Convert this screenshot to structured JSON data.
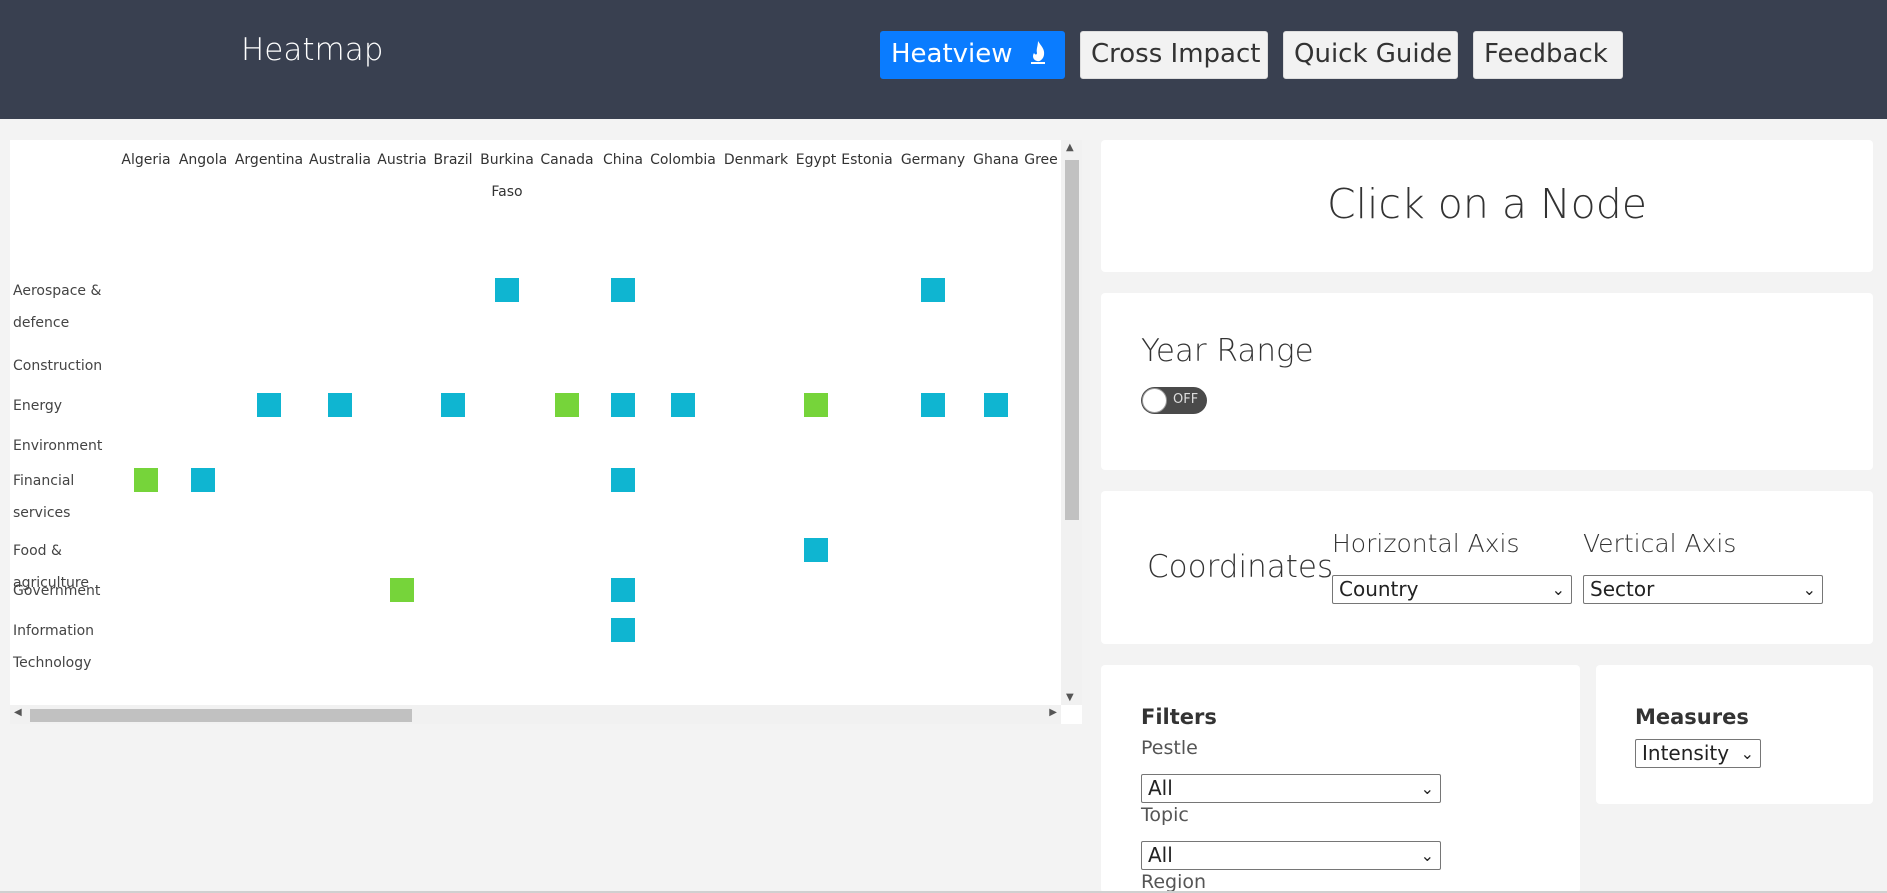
{
  "header": {
    "brand": "Heatmap",
    "nav": [
      {
        "label": "Heatview",
        "active": true,
        "icon": "flame-icon"
      },
      {
        "label": "Cross Impact",
        "active": false
      },
      {
        "label": "Quick Guide",
        "active": false
      },
      {
        "label": "Feedback",
        "active": false
      }
    ]
  },
  "colors": {
    "header_bg": "#394050",
    "active_nav": "#0a7cff",
    "cell_blue": "#0fb5d1",
    "cell_green": "#76d43a"
  },
  "chart_data": {
    "type": "heatmap",
    "x_categories": [
      "Algeria",
      "Angola",
      "Argentina",
      "Australia",
      "Austria",
      "Brazil",
      "Burkina Faso",
      "Canada",
      "China",
      "Colombia",
      "Denmark",
      "Egypt",
      "Estonia",
      "Germany",
      "Ghana",
      "Gree"
    ],
    "y_categories": [
      "Aerospace & defence",
      "Construction",
      "Energy",
      "Environment",
      "Financial services",
      "Food & agriculture",
      "Government",
      "Information Technology"
    ],
    "cells": [
      {
        "x": "Burkina Faso",
        "y": "Aerospace & defence",
        "color": "blue"
      },
      {
        "x": "China",
        "y": "Aerospace & defence",
        "color": "blue"
      },
      {
        "x": "Germany",
        "y": "Aerospace & defence",
        "color": "blue"
      },
      {
        "x": "Argentina",
        "y": "Energy",
        "color": "blue"
      },
      {
        "x": "Australia",
        "y": "Energy",
        "color": "blue"
      },
      {
        "x": "Brazil",
        "y": "Energy",
        "color": "blue"
      },
      {
        "x": "Canada",
        "y": "Energy",
        "color": "green"
      },
      {
        "x": "China",
        "y": "Energy",
        "color": "blue"
      },
      {
        "x": "Colombia",
        "y": "Energy",
        "color": "blue"
      },
      {
        "x": "Egypt",
        "y": "Energy",
        "color": "green"
      },
      {
        "x": "Germany",
        "y": "Energy",
        "color": "blue"
      },
      {
        "x": "Ghana",
        "y": "Energy",
        "color": "blue"
      },
      {
        "x": "Algeria",
        "y": "Financial services",
        "color": "green"
      },
      {
        "x": "Angola",
        "y": "Financial services",
        "color": "blue"
      },
      {
        "x": "China",
        "y": "Financial services",
        "color": "blue"
      },
      {
        "x": "Egypt",
        "y": "Food & agriculture",
        "color": "blue"
      },
      {
        "x": "Austria",
        "y": "Government",
        "color": "green"
      },
      {
        "x": "China",
        "y": "Government",
        "color": "blue"
      },
      {
        "x": "China",
        "y": "Information Technology",
        "color": "blue"
      }
    ]
  },
  "node_card": {
    "title": "Click on a Node"
  },
  "year_range": {
    "title": "Year Range",
    "toggle": "OFF"
  },
  "coordinates": {
    "title": "Coordinates",
    "horizontal_label": "Horizontal Axis",
    "horizontal_value": "Country",
    "vertical_label": "Vertical Axis",
    "vertical_value": "Sector"
  },
  "filters": {
    "title": "Filters",
    "pestle_label": "Pestle",
    "pestle_value": "All",
    "topic_label": "Topic",
    "topic_value": "All",
    "region_label": "Region"
  },
  "measures": {
    "title": "Measures",
    "value": "Intensity"
  }
}
